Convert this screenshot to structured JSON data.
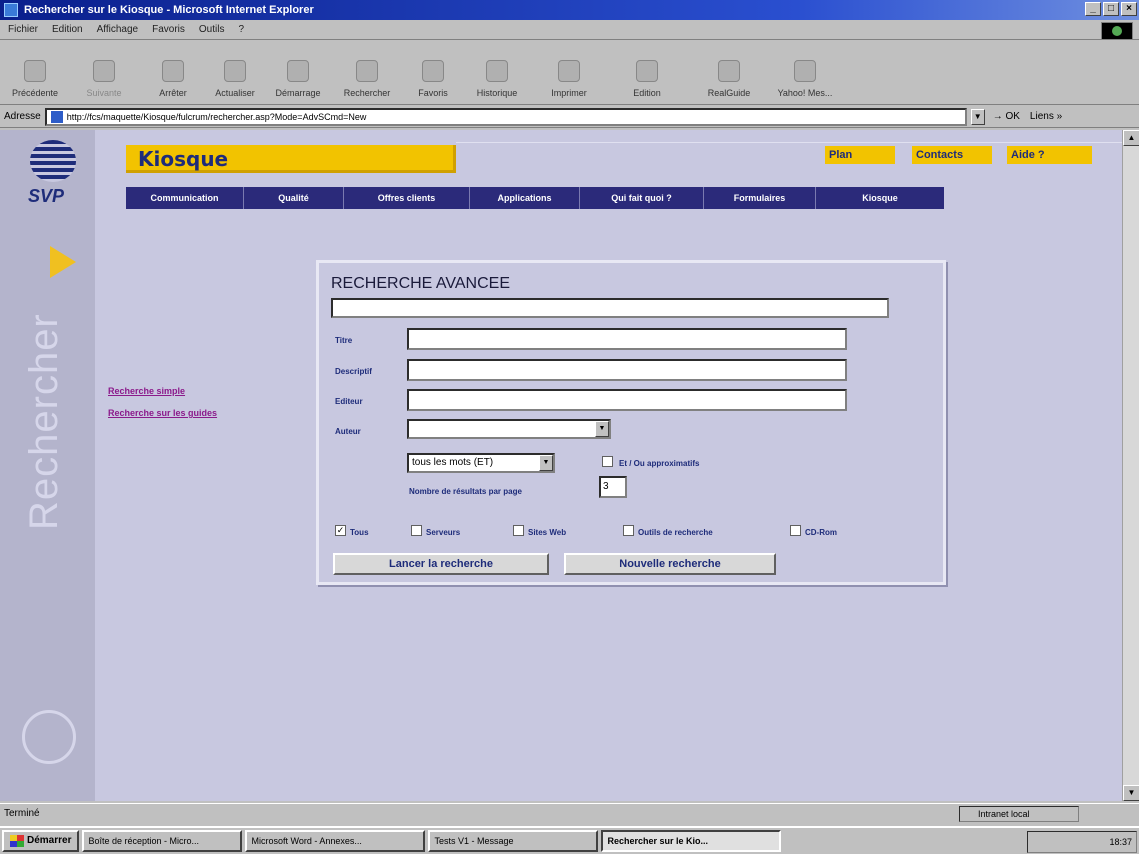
{
  "window": {
    "title": "Rechercher sur le Kiosque - Microsoft Internet Explorer",
    "buttons": [
      "_",
      "□",
      "×"
    ]
  },
  "menubar": [
    "Fichier",
    "Edition",
    "Affichage",
    "Favoris",
    "Outils",
    "?"
  ],
  "toolbar": [
    {
      "label": "Précédente",
      "icon": "back-arrow-icon",
      "disabled": false
    },
    {
      "label": "Suivante",
      "icon": "forward-arrow-icon",
      "disabled": true
    },
    {
      "label": "Arrêter",
      "icon": "stop-icon",
      "disabled": false
    },
    {
      "label": "Actualiser",
      "icon": "refresh-icon",
      "disabled": false
    },
    {
      "label": "Démarrage",
      "icon": "home-icon",
      "disabled": false
    },
    {
      "label": "Rechercher",
      "icon": "search-icon",
      "disabled": false
    },
    {
      "label": "Favoris",
      "icon": "favorites-icon",
      "disabled": false
    },
    {
      "label": "Historique",
      "icon": "history-icon",
      "disabled": false
    },
    {
      "label": "Imprimer",
      "icon": "print-icon",
      "disabled": false
    },
    {
      "label": "Edition",
      "icon": "edit-icon",
      "disabled": false
    },
    {
      "label": "RealGuide",
      "icon": "realguide-icon",
      "disabled": false
    },
    {
      "label": "Yahoo! Mes...",
      "icon": "yahoo-icon",
      "disabled": false
    }
  ],
  "address": {
    "label": "Adresse",
    "url": "http://fcs/maquette/Kiosque/fulcrum/rechercher.asp?Mode=AdvSCmd=New",
    "go": "OK",
    "links": "Liens »"
  },
  "site": {
    "logo_text": "SVP",
    "banner": "Kiosque",
    "vertical_text": "Rechercher",
    "toplinks": [
      "Plan",
      "Contacts",
      "Aide ?"
    ],
    "nav": [
      "Communication",
      "Qualité",
      "Offres clients",
      "Applications",
      "Qui fait quoi ?",
      "Formulaires",
      "Kiosque"
    ],
    "sidelinks": [
      "Recherche simple",
      "Recherche sur les guides"
    ]
  },
  "search": {
    "title": "RECHERCHE AVANCEE",
    "fields": [
      {
        "label": "Titre",
        "value": ""
      },
      {
        "label": "Descriptif",
        "value": ""
      },
      {
        "label": "Editeur",
        "value": ""
      }
    ],
    "author_label": "Auteur",
    "author_value": "",
    "mode_select": "tous les mots (ET)",
    "approx_label": "Et / Ou approximatifs",
    "approx_checked": false,
    "results_label": "Nombre de résultats par page",
    "results_value": "3",
    "sources": [
      {
        "label": "Tous",
        "checked": true
      },
      {
        "label": "Serveurs",
        "checked": false
      },
      {
        "label": "Sites Web",
        "checked": false
      },
      {
        "label": "Outils de recherche",
        "checked": false
      },
      {
        "label": "CD-Rom",
        "checked": false
      }
    ],
    "btn_search": "Lancer la recherche",
    "btn_new": "Nouvelle recherche"
  },
  "status": {
    "text": "Terminé",
    "zone": "Intranet local"
  },
  "taskbar": {
    "start": "Démarrer",
    "tasks": [
      {
        "label": "Boîte de réception - Micro...",
        "active": false
      },
      {
        "label": "Microsoft Word - Annexes...",
        "active": false
      },
      {
        "label": "Tests V1 - Message",
        "active": false
      },
      {
        "label": "Rechercher sur le Kio...",
        "active": true
      }
    ],
    "clock": "18:37"
  }
}
